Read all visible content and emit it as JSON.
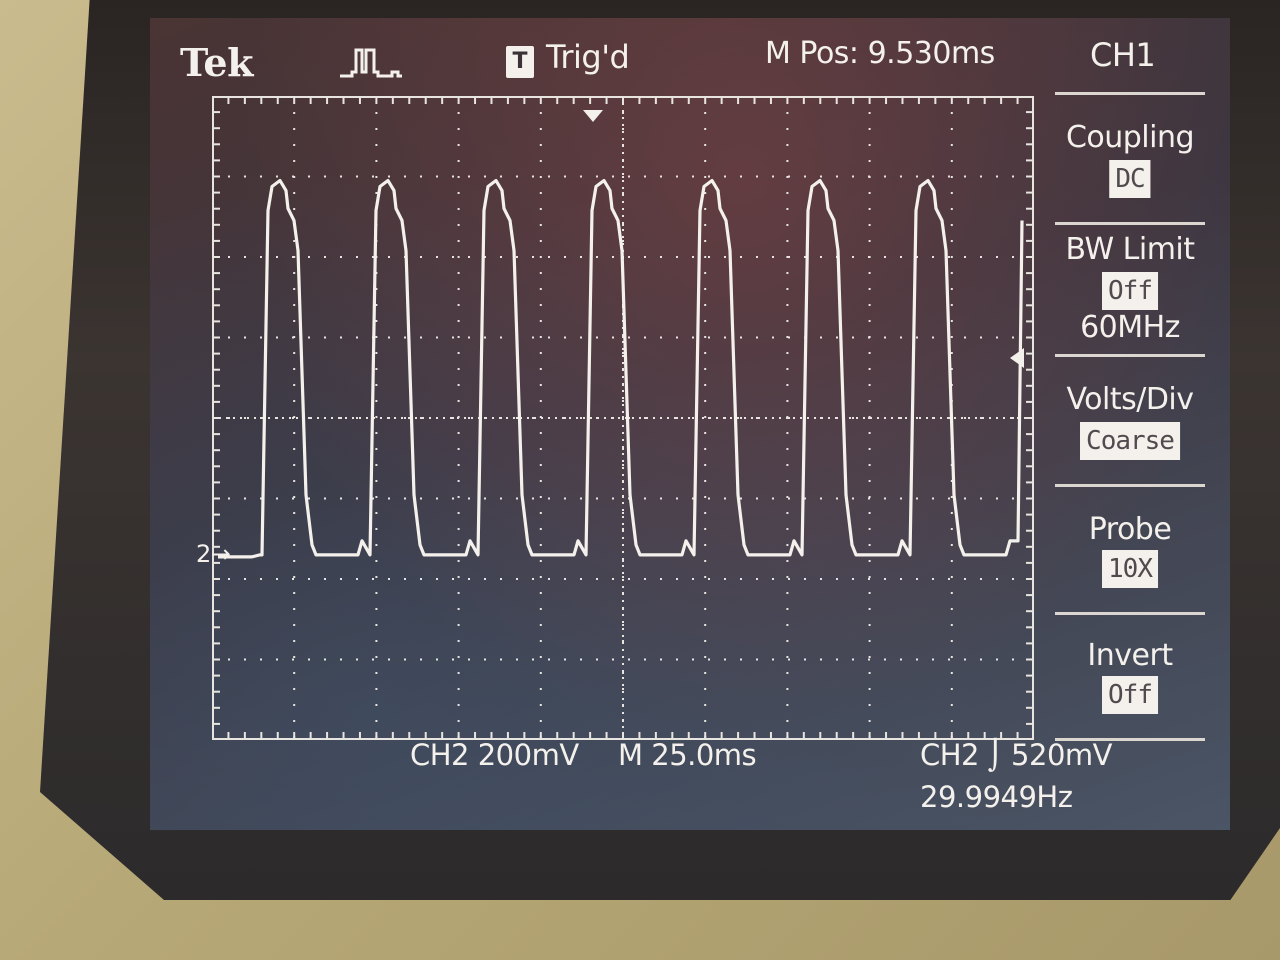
{
  "header": {
    "brand": "Tek",
    "acquisition_icon": "acquisition-waveform-icon",
    "trigger_badge": "T",
    "trigger_status": "Trig'd",
    "main_position": "M Pos: 9.530ms",
    "menu_title": "CH1"
  },
  "side_menu": {
    "items": [
      {
        "label": "Coupling",
        "value": "DC"
      },
      {
        "label": "BW Limit",
        "value": "Off",
        "sub": "60MHz"
      },
      {
        "label": "Volts/Div",
        "value": "Coarse"
      },
      {
        "label": "Probe",
        "value": "10X"
      },
      {
        "label": "Invert",
        "value": "Off"
      }
    ]
  },
  "status_bar": {
    "channel_scale": "CH2  200mV",
    "time_scale": "M 25.0ms",
    "trigger_level": "CH2 ⌡ 520mV",
    "frequency": "29.9949Hz"
  },
  "markers": {
    "ground_marker": "2→"
  },
  "waveform": {
    "channel": "CH2",
    "pulse_count": 7,
    "low_level_div": -1.7,
    "high_level_div": 2.95,
    "color": "#f4f1ec"
  },
  "colors": {
    "screen_text": "#f4f1ec",
    "bezel": "#bdb08a"
  }
}
